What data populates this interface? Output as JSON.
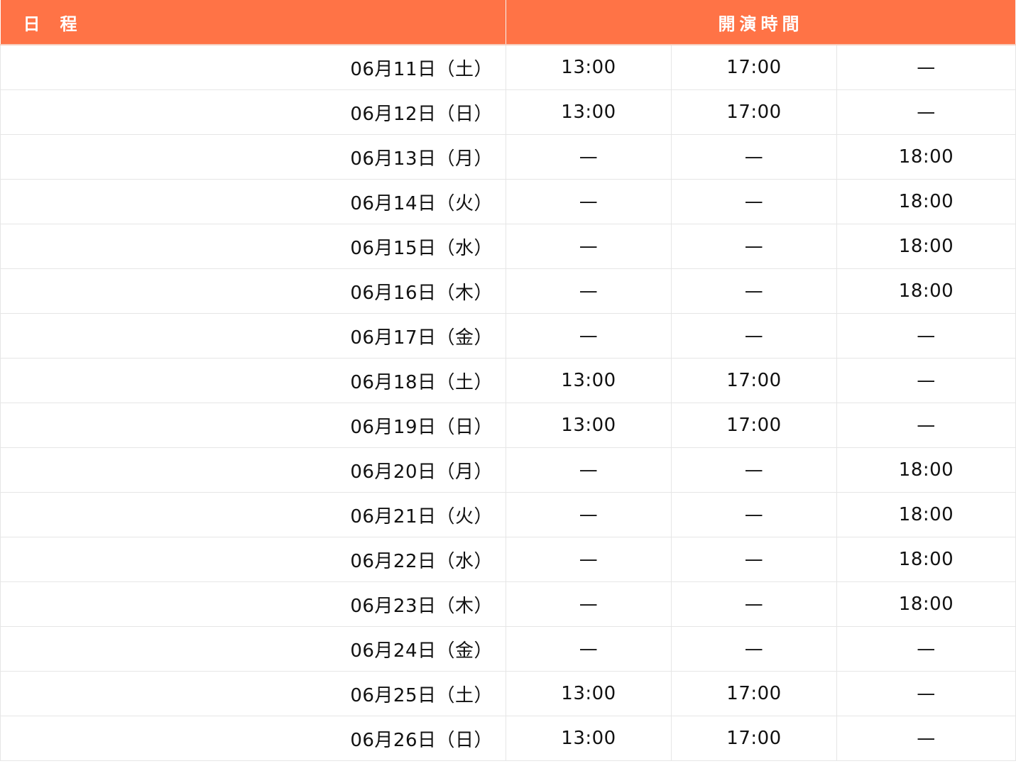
{
  "header": {
    "date_label_a": "日",
    "date_label_b": "程",
    "time_label": "開演時間"
  },
  "colors": {
    "header_bg": "#ff7346",
    "header_text": "#ffffff",
    "grid_line": "#e6e6e6"
  },
  "rows": [
    {
      "date": "06月11日（土）",
      "t1": "13:00",
      "t2": "17:00",
      "t3": "—"
    },
    {
      "date": "06月12日（日）",
      "t1": "13:00",
      "t2": "17:00",
      "t3": "—"
    },
    {
      "date": "06月13日（月）",
      "t1": "—",
      "t2": "—",
      "t3": "18:00"
    },
    {
      "date": "06月14日（火）",
      "t1": "—",
      "t2": "—",
      "t3": "18:00"
    },
    {
      "date": "06月15日（水）",
      "t1": "—",
      "t2": "—",
      "t3": "18:00"
    },
    {
      "date": "06月16日（木）",
      "t1": "—",
      "t2": "—",
      "t3": "18:00"
    },
    {
      "date": "06月17日（金）",
      "t1": "—",
      "t2": "—",
      "t3": "—"
    },
    {
      "date": "06月18日（土）",
      "t1": "13:00",
      "t2": "17:00",
      "t3": "—"
    },
    {
      "date": "06月19日（日）",
      "t1": "13:00",
      "t2": "17:00",
      "t3": "—"
    },
    {
      "date": "06月20日（月）",
      "t1": "—",
      "t2": "—",
      "t3": "18:00"
    },
    {
      "date": "06月21日（火）",
      "t1": "—",
      "t2": "—",
      "t3": "18:00"
    },
    {
      "date": "06月22日（水）",
      "t1": "—",
      "t2": "—",
      "t3": "18:00"
    },
    {
      "date": "06月23日（木）",
      "t1": "—",
      "t2": "—",
      "t3": "18:00"
    },
    {
      "date": "06月24日（金）",
      "t1": "—",
      "t2": "—",
      "t3": "—"
    },
    {
      "date": "06月25日（土）",
      "t1": "13:00",
      "t2": "17:00",
      "t3": "—"
    },
    {
      "date": "06月26日（日）",
      "t1": "13:00",
      "t2": "17:00",
      "t3": "—"
    }
  ]
}
